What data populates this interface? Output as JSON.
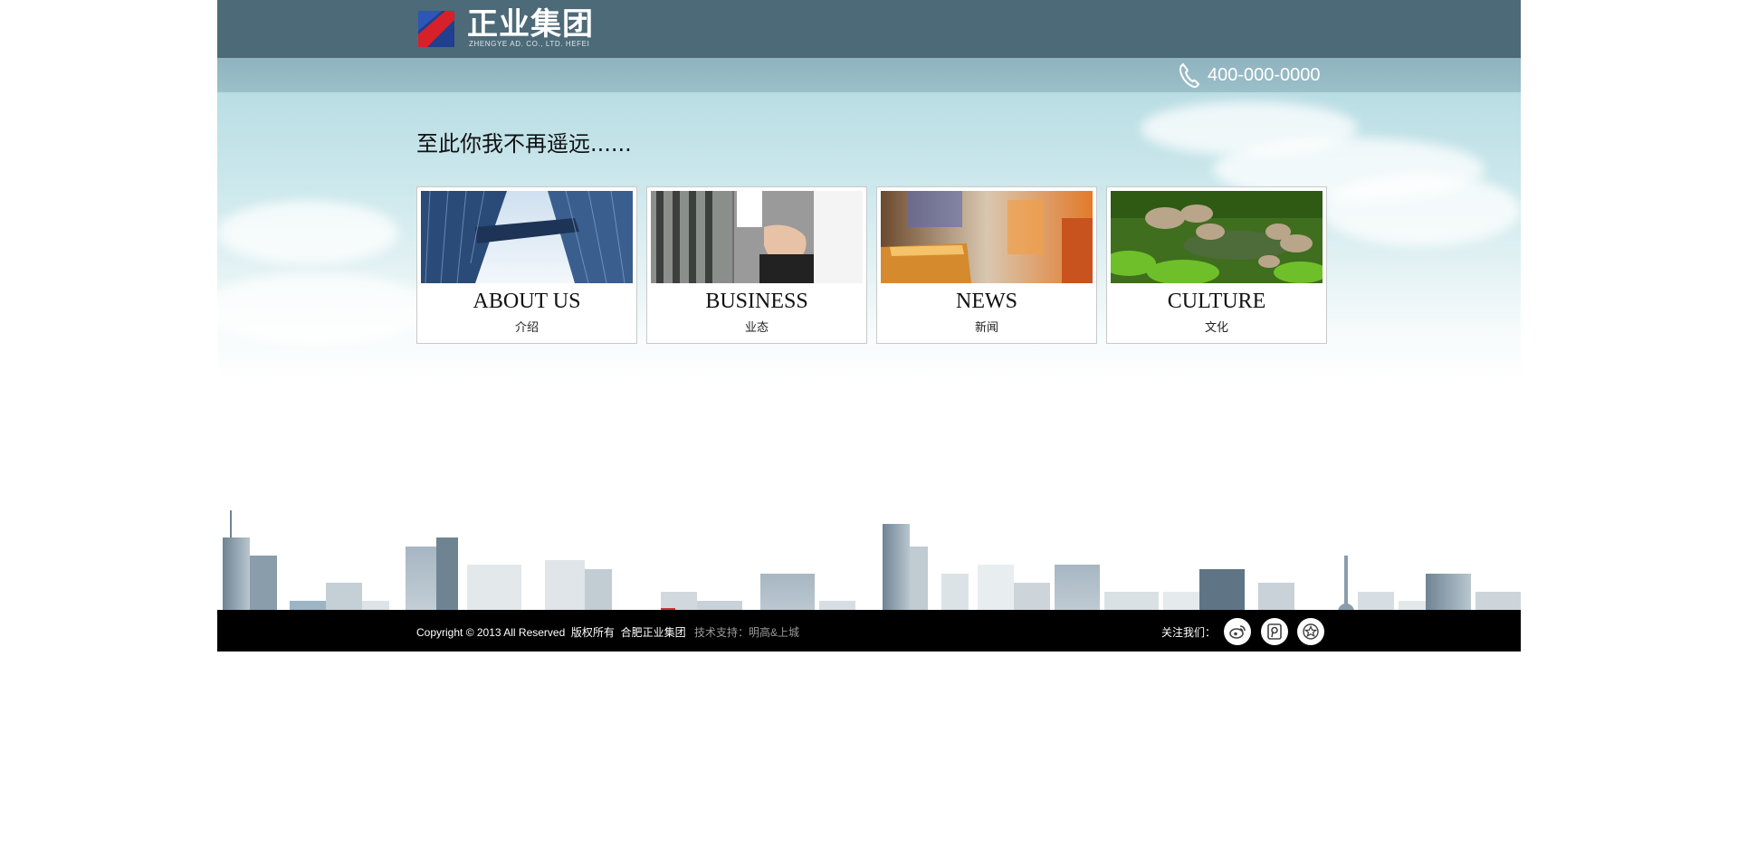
{
  "header": {
    "logo_title": "正业集团",
    "logo_subtitle": "ZHENGYE AD. CO., LTD. HEFEI",
    "phone": "400-000-0000",
    "phone_icon": "phone-icon"
  },
  "hero": {
    "slogan": "至此你我不再遥远......"
  },
  "cards": [
    {
      "title": "ABOUT US",
      "subtitle": "介绍"
    },
    {
      "title": "BUSINESS",
      "subtitle": "业态"
    },
    {
      "title": "NEWS",
      "subtitle": "新闻"
    },
    {
      "title": "CULTURE",
      "subtitle": "文化"
    }
  ],
  "footer": {
    "copyright": "Copyright © 2013 All Reserved  版权所有  合肥正业集团",
    "support": "技术支持：明高&上城",
    "follow_label": "关注我们：",
    "social": [
      "weibo-icon",
      "tencent-weibo-icon",
      "favorite-star-icon"
    ]
  },
  "colors": {
    "header_bg": "#4d6a78",
    "phone_bar_bg": "#9cc0c9",
    "footer_bg": "#000000",
    "logo_red": "#d6202a",
    "logo_blue": "#1f3f8f"
  }
}
